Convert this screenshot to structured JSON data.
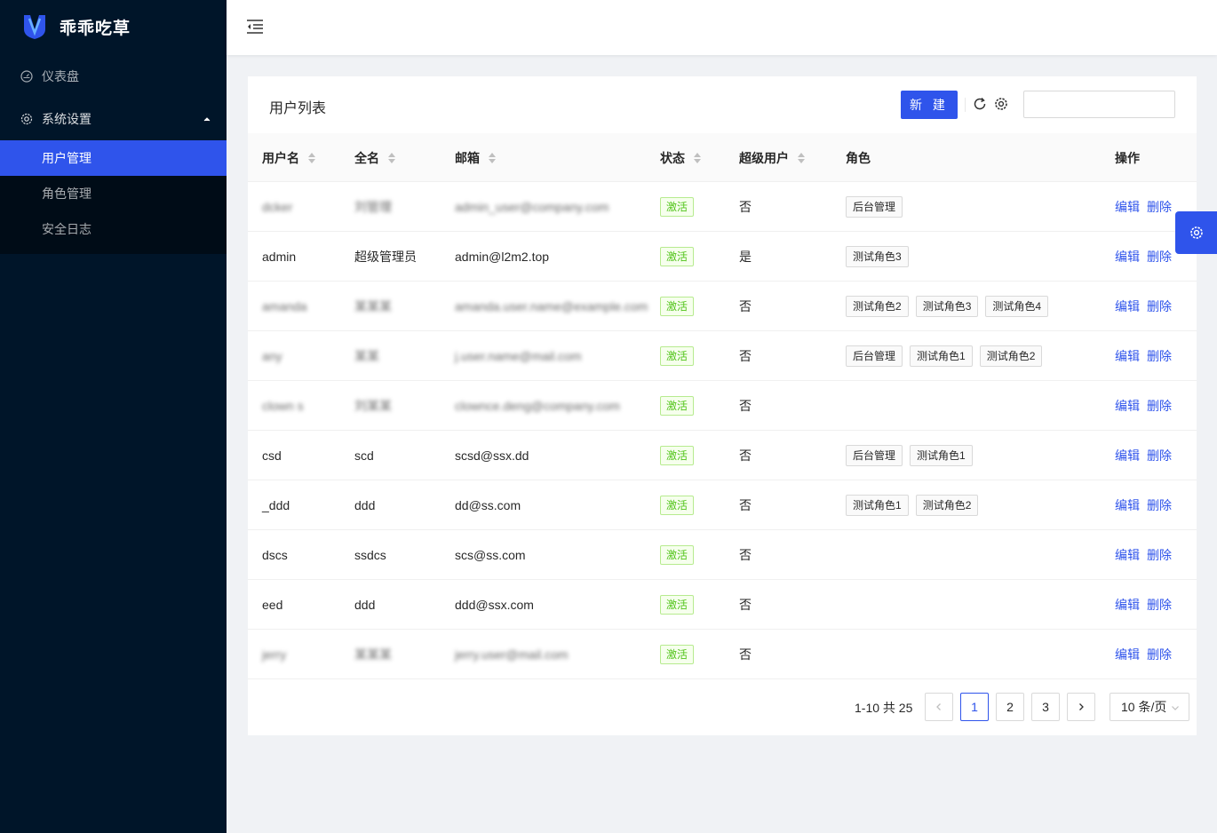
{
  "app": {
    "title": "乖乖吃草"
  },
  "sidebar": {
    "items": [
      {
        "label": "仪表盘",
        "icon": "dashboard-icon"
      },
      {
        "label": "系统设置",
        "icon": "setting-icon"
      }
    ],
    "submenu": [
      {
        "label": "用户管理",
        "active": true
      },
      {
        "label": "角色管理",
        "active": false
      },
      {
        "label": "安全日志",
        "active": false
      }
    ]
  },
  "header": {
    "fold_icon": "menu-fold-icon"
  },
  "card": {
    "title": "用户列表",
    "new_label": "新 建",
    "search": {
      "placeholder": ""
    }
  },
  "table": {
    "columns": [
      "用户名",
      "全名",
      "邮箱",
      "状态",
      "超级用户",
      "角色",
      "操作"
    ],
    "rows": [
      {
        "username": "dcker",
        "fullname": "刘管理",
        "email": "admin_user@company.com",
        "status": "激活",
        "superuser": "否",
        "roles": [
          "后台管理"
        ],
        "blurred": true
      },
      {
        "username": "admin",
        "fullname": "超级管理员",
        "email": "admin@l2m2.top",
        "status": "激活",
        "superuser": "是",
        "roles": [
          "测试角色3"
        ],
        "blurred": false
      },
      {
        "username": "amanda",
        "fullname": "某某某",
        "email": "amanda.user.name@example.com",
        "status": "激活",
        "superuser": "否",
        "roles": [
          "测试角色2",
          "测试角色3",
          "测试角色4"
        ],
        "blurred": true
      },
      {
        "username": "any",
        "fullname": "某某",
        "email": "j.user.name@mail.com",
        "status": "激活",
        "superuser": "否",
        "roles": [
          "后台管理",
          "测试角色1",
          "测试角色2"
        ],
        "blurred": true
      },
      {
        "username": "clown s",
        "fullname": "刘某某",
        "email": "clownce.deng@company.com",
        "status": "激活",
        "superuser": "否",
        "roles": [],
        "blurred": true
      },
      {
        "username": "csd",
        "fullname": "scd",
        "email": "scsd@ssx.dd",
        "status": "激活",
        "superuser": "否",
        "roles": [
          "后台管理",
          "测试角色1"
        ],
        "blurred": false
      },
      {
        "username": "_ddd",
        "fullname": "ddd",
        "email": "dd@ss.com",
        "status": "激活",
        "superuser": "否",
        "roles": [
          "测试角色1",
          "测试角色2"
        ],
        "blurred": false
      },
      {
        "username": "dscs",
        "fullname": "ssdcs",
        "email": "scs@ss.com",
        "status": "激活",
        "superuser": "否",
        "roles": [],
        "blurred": false
      },
      {
        "username": "eed",
        "fullname": "ddd",
        "email": "ddd@ssx.com",
        "status": "激活",
        "superuser": "否",
        "roles": [],
        "blurred": false
      },
      {
        "username": "jerry",
        "fullname": "某某某",
        "email": "jerry.user@mail.com",
        "status": "激活",
        "superuser": "否",
        "roles": [],
        "blurred": true
      }
    ],
    "actions": {
      "edit": "编辑",
      "delete": "删除"
    }
  },
  "pagination": {
    "total_text": "1-10 共 25",
    "pages": [
      "1",
      "2",
      "3"
    ],
    "current": "1",
    "page_size": "10 条/页"
  },
  "colors": {
    "primary": "#2f54eb",
    "sidebar_bg": "#001529",
    "success": "#52c41a"
  }
}
